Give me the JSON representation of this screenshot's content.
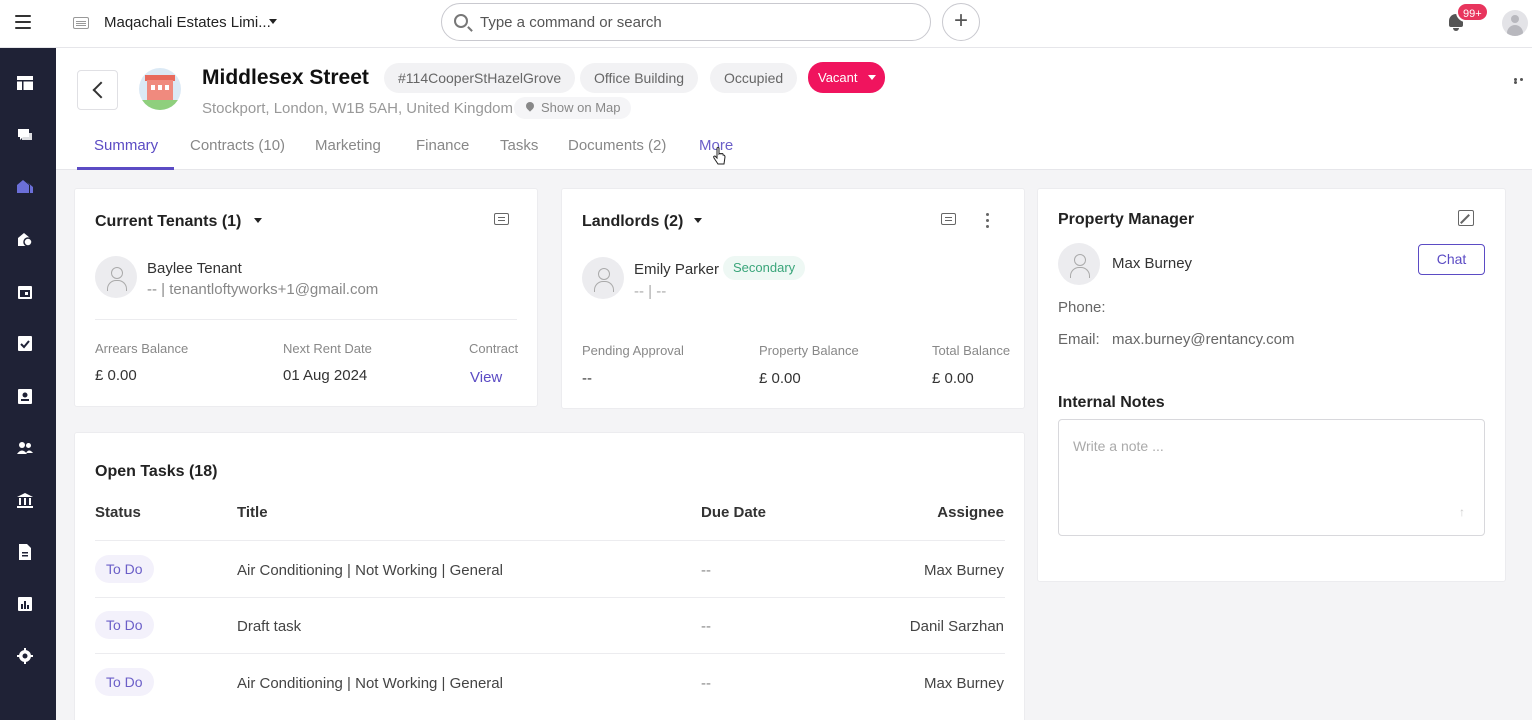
{
  "topbar": {
    "org_name": "Maqachali Estates Limi...",
    "search_placeholder": "Type a command or search",
    "add_label": "+",
    "notifications_badge": "99+"
  },
  "sidebar": {
    "items": [
      "dashboard",
      "messages",
      "properties",
      "finance",
      "calendar",
      "tasks",
      "contacts",
      "people",
      "banking",
      "documents",
      "reports",
      "settings"
    ],
    "active": "properties"
  },
  "property": {
    "title": "Middlesex Street",
    "reference": "#114CooperStHazelGrove",
    "type": "Office Building",
    "occupancy": "Occupied",
    "status": "Vacant",
    "address": "Stockport, London, W1B 5AH, United Kingdom",
    "map_link": "Show on Map"
  },
  "tabs": [
    {
      "label": "Summary",
      "active": true
    },
    {
      "label": "Contracts (10)"
    },
    {
      "label": "Marketing"
    },
    {
      "label": "Finance"
    },
    {
      "label": "Tasks"
    },
    {
      "label": "Documents (2)"
    },
    {
      "label": "More"
    }
  ],
  "tenants": {
    "title": "Current Tenants (1)",
    "name": "Baylee Tenant",
    "contact": "-- | tenantloftyworks+1@gmail.com",
    "arrears_label": "Arrears Balance",
    "arrears_value": "£ 0.00",
    "next_rent_label": "Next Rent Date",
    "next_rent_value": "01 Aug 2024",
    "contract_label": "Contract",
    "contract_link": "View"
  },
  "landlords": {
    "title": "Landlords (2)",
    "name": "Emily Parker",
    "badge": "Secondary",
    "contact": "-- | --",
    "pending_label": "Pending Approval",
    "pending_value": "--",
    "property_balance_label": "Property Balance",
    "property_balance_value": "£ 0.00",
    "total_balance_label": "Total Balance",
    "total_balance_value": "£ 0.00"
  },
  "manager": {
    "title": "Property Manager",
    "name": "Max Burney",
    "chat_label": "Chat",
    "phone_label": "Phone:",
    "phone_value": "",
    "email_label": "Email:",
    "email_value": "max.burney@rentancy.com"
  },
  "notes": {
    "title": "Internal Notes",
    "placeholder": "Write a note ..."
  },
  "tasks": {
    "title": "Open Tasks (18)",
    "columns": [
      "Status",
      "Title",
      "Due Date",
      "Assignee"
    ],
    "rows": [
      {
        "status": "To Do",
        "title": "Air Conditioning | Not Working | General",
        "due": "--",
        "assignee": "Max Burney"
      },
      {
        "status": "To Do",
        "title": "Draft task",
        "due": "--",
        "assignee": "Danil Sarzhan"
      },
      {
        "status": "To Do",
        "title": "Air Conditioning | Not Working | General",
        "due": "--",
        "assignee": "Max Burney"
      }
    ]
  },
  "colors": {
    "accent": "#5b4bc4",
    "vacant": "#f0145e",
    "sidebar": "#1f2236",
    "badge": "#e8355d"
  }
}
